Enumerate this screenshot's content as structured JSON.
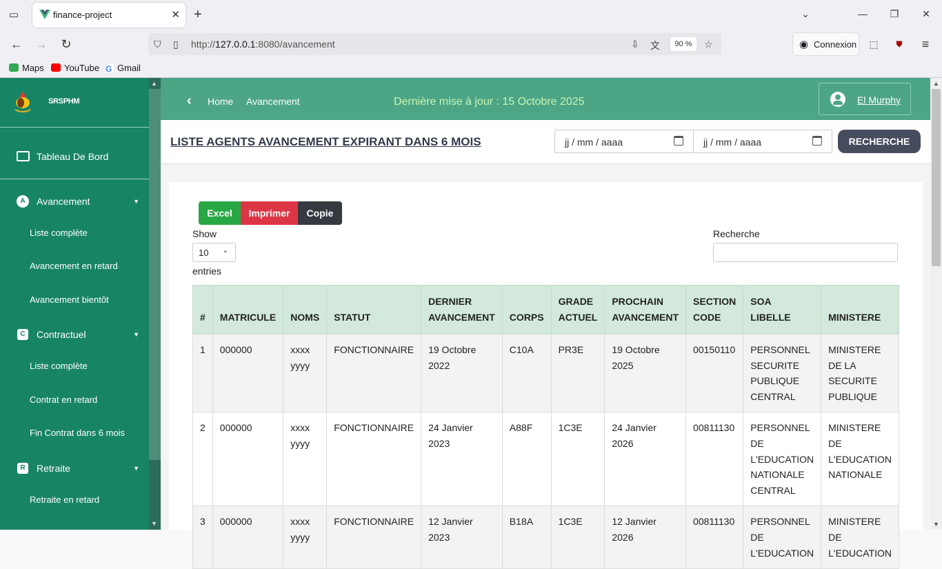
{
  "browser": {
    "tab_title": "finance-project",
    "url_prefix": "http://",
    "url_host": "127.0.0.1",
    "url_rest": ":8080/avancement",
    "zoom": "90 %",
    "connexion": "Connexion",
    "bookmarks": [
      {
        "label": "Maps",
        "color": "#34a853"
      },
      {
        "label": "YouTube",
        "color": "#ff0000"
      },
      {
        "label": "Gmail",
        "color": "#4285f4"
      }
    ]
  },
  "sidebar": {
    "brand": "SRSPHM",
    "dashboard": "Tableau De Bord",
    "sections": [
      {
        "label": "Avancement",
        "icon": "A",
        "items": [
          "Liste complète",
          "Avancement en retard",
          "Avancement bientôt"
        ]
      },
      {
        "label": "Contractuel",
        "icon": "C",
        "items": [
          "Liste complète",
          "Contrat en retard",
          "Fin Contrat dans 6 mois"
        ]
      },
      {
        "label": "Retraite",
        "icon": "R",
        "items": [
          "Retraite en retard"
        ]
      }
    ]
  },
  "header": {
    "crumb_home": "Home",
    "crumb_current": "Avancement",
    "last_update": "Dernière mise à jour : 15 Octobre 2025",
    "user": "El Murphy"
  },
  "filter": {
    "title": "LISTE AGENTS AVANCEMENT EXPIRANT DANS 6 MOIS",
    "date1_placeholder": "jj / mm / aaaa",
    "date2_placeholder": "jj / mm / aaaa",
    "search_button": "RECHERCHE"
  },
  "table_tools": {
    "excel": "Excel",
    "print": "Imprimer",
    "copy": "Copie",
    "show": "Show",
    "page_size": "10",
    "entries": "entries",
    "search_label": "Recherche"
  },
  "table": {
    "headers": [
      "#",
      "MATRICULE",
      "NOMS",
      "STATUT",
      "DERNIER AVANCEMENT",
      "CORPS",
      "GRADE ACTUEL",
      "PROCHAIN AVANCEMENT",
      "SECTION CODE",
      "SOA LIBELLE",
      "MINISTERE"
    ],
    "rows": [
      [
        "1",
        "000000",
        "xxxx yyyy",
        "FONCTIONNAIRE",
        "19 Octobre 2022",
        "C10A",
        "PR3E",
        "19 Octobre 2025",
        "00150110",
        "PERSONNEL SECURITE PUBLIQUE CENTRAL",
        "MINISTERE DE LA SECURITE PUBLIQUE"
      ],
      [
        "2",
        "000000",
        "xxxx yyyy",
        "FONCTIONNAIRE",
        "24 Janvier 2023",
        "A88F",
        "1C3E",
        "24 Janvier 2026",
        "00811130",
        "PERSONNEL DE L'EDUCATION NATIONALE CENTRAL",
        "MINISTERE DE L'EDUCATION NATIONALE"
      ],
      [
        "3",
        "000000",
        "xxxx yyyy",
        "FONCTIONNAIRE",
        "12 Janvier 2023",
        "B18A",
        "1C3E",
        "12 Janvier 2026",
        "00811130",
        "PERSONNEL DE L'EDUCATION",
        "MINISTERE DE L'EDUCATION"
      ]
    ]
  }
}
